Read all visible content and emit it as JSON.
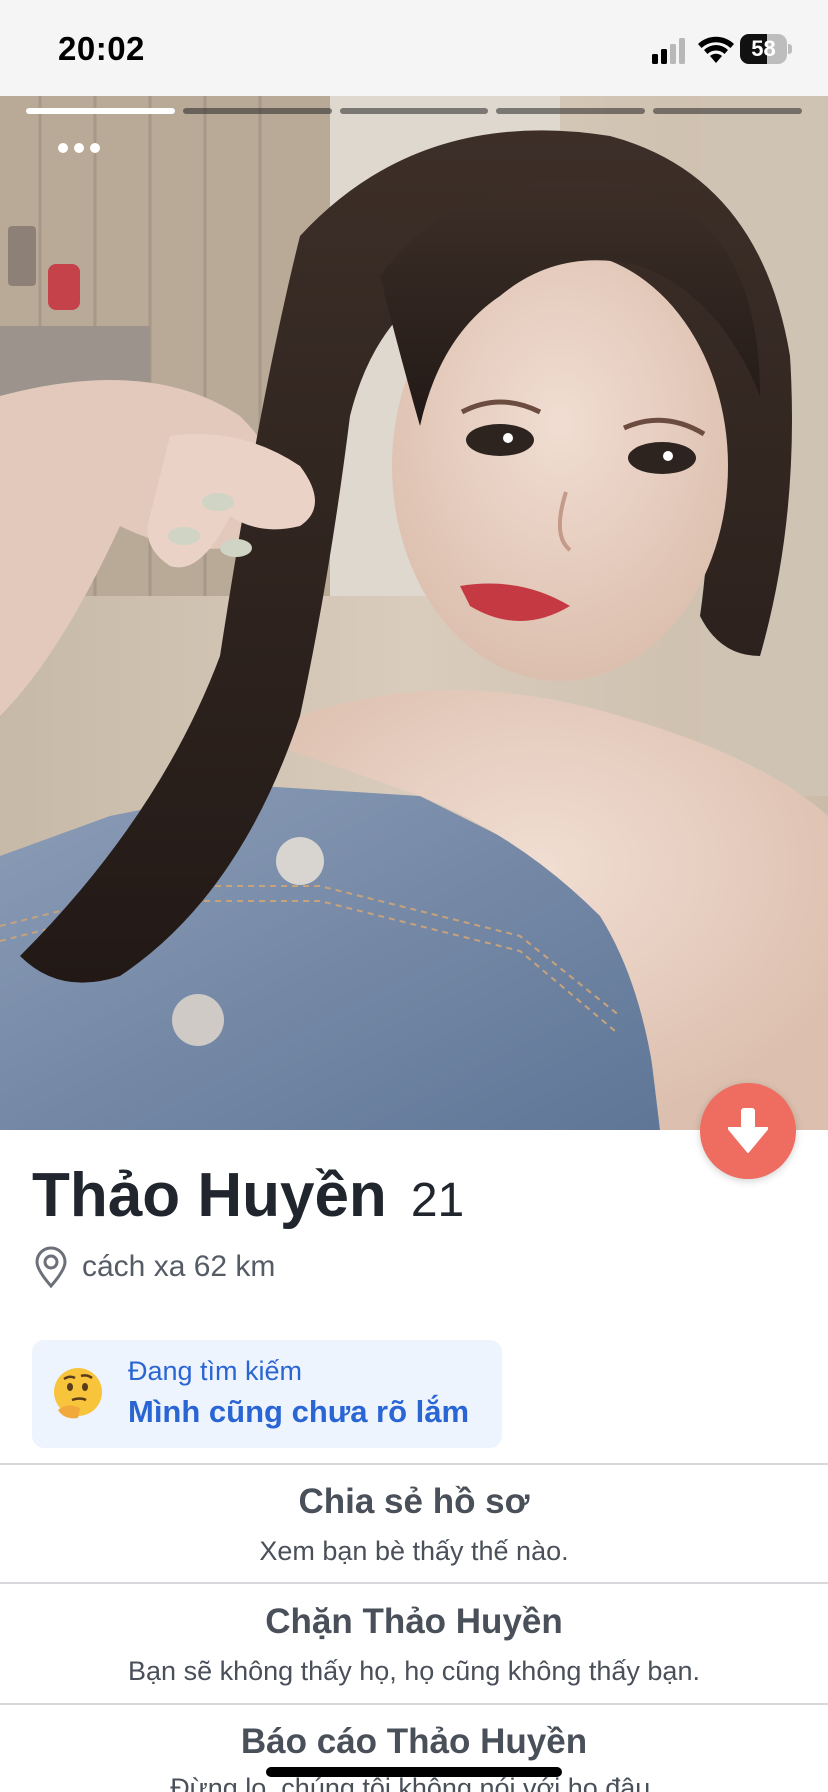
{
  "status_bar": {
    "time": "20:02",
    "battery_level": "58",
    "battery_fraction": 0.58
  },
  "photo": {
    "segments_total": 5,
    "active_segment": 1
  },
  "profile": {
    "name": "Thảo Huyền",
    "age": "21",
    "distance": "cách xa 62 km"
  },
  "looking_for": {
    "label": "Đang tìm kiếm",
    "value": "Mình cũng chưa rõ lắm",
    "icon": "thinking-face-icon"
  },
  "actions": [
    {
      "title": "Chia sẻ hồ sơ",
      "subtitle": "Xem bạn bè thấy thế nào."
    },
    {
      "title": "Chặn Thảo Huyền",
      "subtitle": "Bạn sẽ không thấy họ, họ cũng không thấy bạn."
    },
    {
      "title": "Báo cáo Thảo Huyền",
      "subtitle": "Đừng lo, chúng tôi không nói với họ đâu."
    }
  ],
  "colors": {
    "accent_blue": "#2a65d4",
    "collapse_button": "#ee6c60"
  }
}
